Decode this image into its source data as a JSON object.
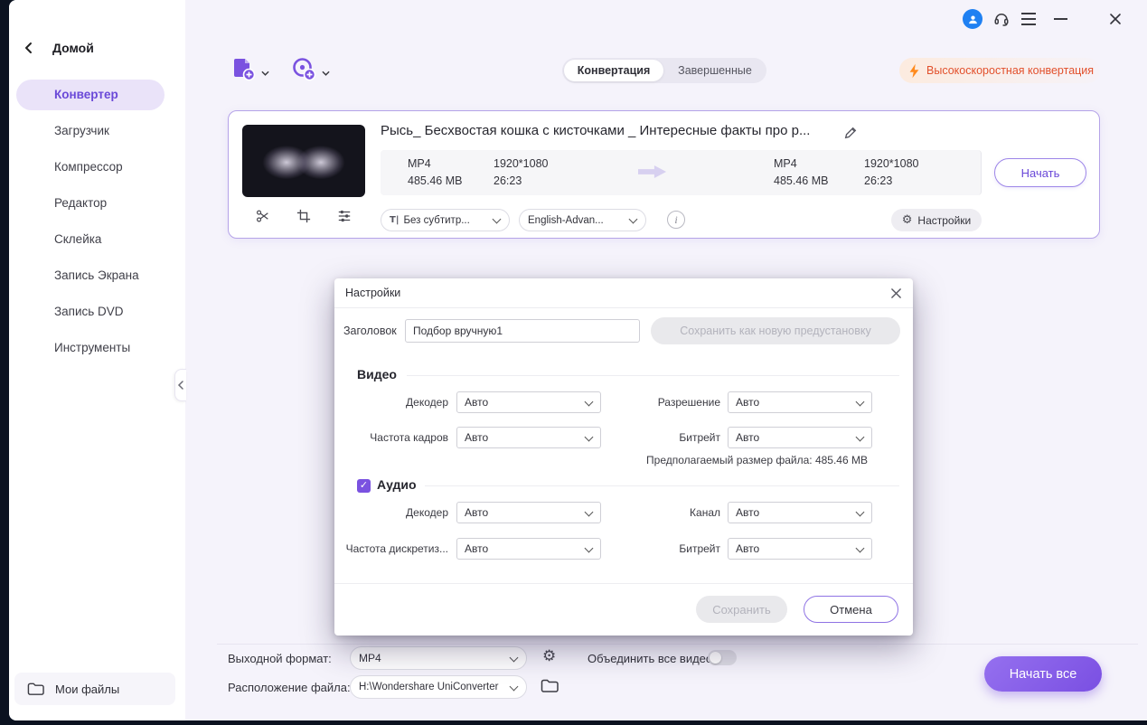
{
  "sidebar": {
    "home_label": "Домой",
    "items": [
      {
        "label": "Конвертер"
      },
      {
        "label": "Загрузчик"
      },
      {
        "label": "Компрессор"
      },
      {
        "label": "Редактор"
      },
      {
        "label": "Склейка"
      },
      {
        "label": "Запись Экрана"
      },
      {
        "label": "Запись DVD"
      },
      {
        "label": "Инструменты"
      }
    ],
    "my_files_label": "Мои файлы"
  },
  "toolbar": {
    "tabs": [
      {
        "label": "Конвертация"
      },
      {
        "label": "Завершенные"
      }
    ],
    "high_speed_label": "Высокоскоростная конвертация"
  },
  "file_card": {
    "title": "Рысь_ Бесхвостая кошка с кисточками _ Интересные факты про р...",
    "source": {
      "format": "MP4",
      "size": "485.46 MB",
      "resolution": "1920*1080",
      "duration": "26:23"
    },
    "target": {
      "format": "MP4",
      "size": "485.46 MB",
      "resolution": "1920*1080",
      "duration": "26:23"
    },
    "start_label": "Начать",
    "subtitle_dropdown": "Без субтитр...",
    "audio_dropdown": "English-Advan...",
    "settings_label": "Настройки"
  },
  "dialog": {
    "title": "Настройки",
    "header_label": "Заголовок",
    "header_value": "Подбор вручную1",
    "save_preset_label": "Сохранить как новую предустановку",
    "video": {
      "title": "Видео",
      "fields": [
        {
          "label": "Декодер",
          "value": "Авто"
        },
        {
          "label": "Разрешение",
          "value": "Авто"
        },
        {
          "label": "Частота кадров",
          "value": "Авто"
        },
        {
          "label": "Битрейт",
          "value": "Авто"
        }
      ],
      "estimated": "Предполагаемый размер файла: 485.46 MB"
    },
    "audio": {
      "title": "Аудио",
      "fields": [
        {
          "label": "Декодер",
          "value": "Авто"
        },
        {
          "label": "Канал",
          "value": "Авто"
        },
        {
          "label": "Частота дискретиз...",
          "value": "Авто"
        },
        {
          "label": "Битрейт",
          "value": "Авто"
        }
      ]
    },
    "save_label": "Сохранить",
    "cancel_label": "Отмена"
  },
  "bottom_bar": {
    "output_format_label": "Выходной формат:",
    "output_format_value": "MP4",
    "merge_label": "Объединить все видео",
    "location_label": "Расположение файла:",
    "location_value": "H:\\Wondershare UniConverter",
    "start_all_label": "Начать все"
  },
  "icons": {
    "subtitle_glyph": "T|",
    "gear_glyph": "⚙",
    "info_glyph": "i",
    "check_glyph": "✓"
  }
}
